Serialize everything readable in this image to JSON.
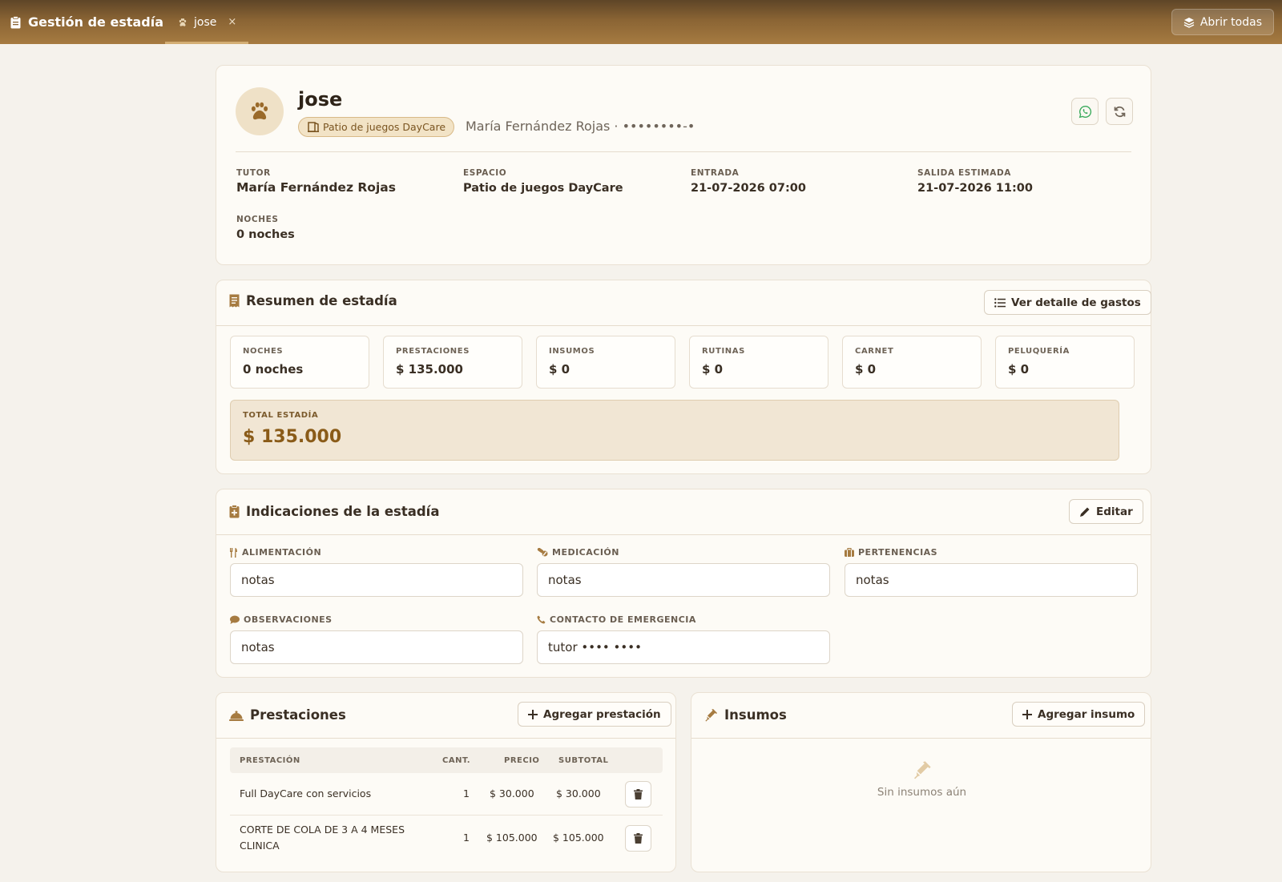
{
  "topbar": {
    "app_title": "Gestión de estadía",
    "tab_label": "jose",
    "tab_close": "×",
    "open_all_label": "Abrir todas"
  },
  "header": {
    "pet_name": "jose",
    "space_chip": "Patio de juegos DayCare",
    "owner_line": "María Fernández Rojas · ••••••••-•",
    "fields": [
      {
        "label": "TUTOR",
        "value": "María Fernández Rojas"
      },
      {
        "label": "ESPACIO",
        "value": "Patio de juegos DayCare"
      },
      {
        "label": "ENTRADA",
        "value": "21-07-2026 07:00"
      },
      {
        "label": "SALIDA ESTIMADA",
        "value": "21-07-2026 11:00"
      },
      {
        "label": "NOCHES",
        "value": "0 noches"
      }
    ]
  },
  "summary": {
    "title": "Resumen de estadía",
    "detail_button": "Ver detalle de gastos",
    "stats": [
      {
        "label": "NOCHES",
        "value": "0 noches"
      },
      {
        "label": "PRESTACIONES",
        "value": "$ 135.000"
      },
      {
        "label": "INSUMOS",
        "value": "$ 0"
      },
      {
        "label": "RUTINAS",
        "value": "$ 0"
      },
      {
        "label": "CARNET",
        "value": "$ 0"
      },
      {
        "label": "PELUQUERÍA",
        "value": "$ 0"
      }
    ],
    "total_label": "TOTAL ESTADÍA",
    "total_value": "$ 135.000"
  },
  "indications": {
    "title": "Indicaciones de la estadía",
    "edit_button": "Editar",
    "fields": [
      {
        "label": "ALIMENTACIÓN",
        "value": "notas"
      },
      {
        "label": "MEDICACIÓN",
        "value": "notas"
      },
      {
        "label": "PERTENENCIAS",
        "value": "notas"
      },
      {
        "label": "OBSERVACIONES",
        "value": "notas"
      },
      {
        "label": "CONTACTO DE EMERGENCIA",
        "value": "tutor •••• ••••"
      }
    ]
  },
  "services": {
    "title": "Prestaciones",
    "add_button": "Agregar prestación",
    "columns": [
      "PRESTACIÓN",
      "CANT.",
      "PRECIO",
      "SUBTOTAL"
    ],
    "rows": [
      {
        "name": "Full DayCare con servicios",
        "name2": "",
        "qty": "1",
        "price": "$ 30.000",
        "subtotal": "$ 30.000"
      },
      {
        "name": "CORTE DE COLA DE 3 A 4 MESES",
        "name2": "CLINICA",
        "qty": "1",
        "price": "$ 105.000",
        "subtotal": "$ 105.000"
      }
    ]
  },
  "supplies": {
    "title": "Insumos",
    "add_button": "Agregar insumo",
    "empty_text": "Sin insumos aún"
  },
  "colors": {
    "brand_brown": "#8a6434",
    "accent_gold": "#a67b41",
    "total_text": "#8a5b18",
    "whatsapp_green": "#3aaa5c"
  }
}
